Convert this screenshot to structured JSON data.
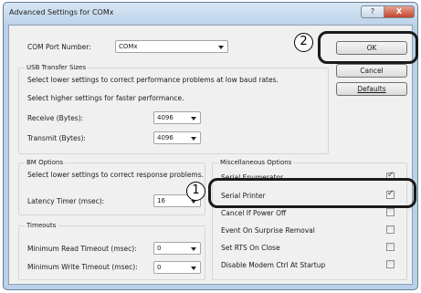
{
  "window": {
    "title": "Advanced Settings for COMx",
    "help_glyph": "?",
    "close_glyph": "X"
  },
  "com_port": {
    "label": "COM Port Number:",
    "value": "COMx"
  },
  "usb": {
    "title": "USB Transfer Sizes",
    "desc1": "Select lower settings to correct performance problems at low baud rates.",
    "desc2": "Select higher settings for faster performance.",
    "receive_label": "Receive (Bytes):",
    "receive_value": "4096",
    "transmit_label": "Transmit (Bytes):",
    "transmit_value": "4096"
  },
  "bm": {
    "title": "BM Options",
    "desc": "Select lower settings to correct response problems.",
    "latency_label": "Latency Timer (msec):",
    "latency_value": "16"
  },
  "timeouts": {
    "title": "Timeouts",
    "read_label": "Minimum Read Timeout (msec):",
    "read_value": "0",
    "write_label": "Minimum Write Timeout (msec):",
    "write_value": "0"
  },
  "misc": {
    "title": "Miscellaneous Options",
    "items": [
      {
        "label": "Serial Enumerator",
        "checked": true
      },
      {
        "label": "Serial Printer",
        "checked": true
      },
      {
        "label": "Cancel If Power Off",
        "checked": false
      },
      {
        "label": "Event On Surprise Removal",
        "checked": false
      },
      {
        "label": "Set RTS On Close",
        "checked": false
      },
      {
        "label": "Disable Modem Ctrl At Startup",
        "checked": false
      }
    ]
  },
  "buttons": {
    "ok": "OK",
    "cancel": "Cancel",
    "defaults": "Defaults"
  },
  "callouts": {
    "one": "1",
    "two": "2"
  }
}
